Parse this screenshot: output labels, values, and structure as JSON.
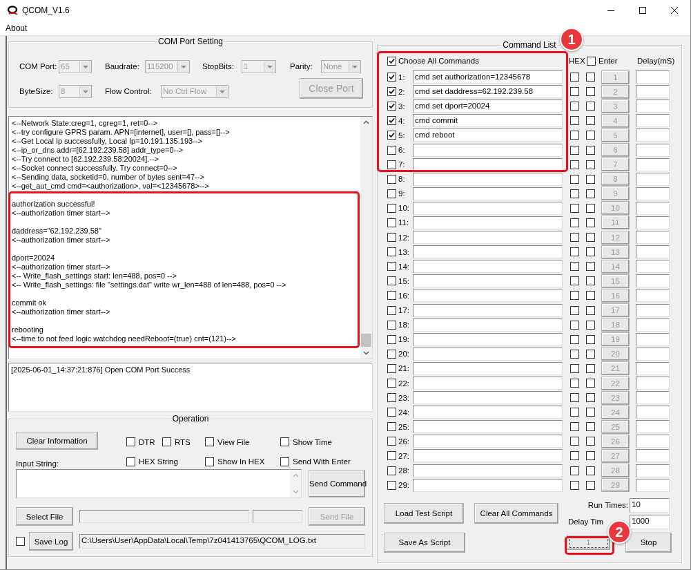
{
  "window": {
    "title": "QCOM_V1.6"
  },
  "menu": [
    "About"
  ],
  "com_port_setting": {
    "title": "COM Port Setting",
    "fields": [
      {
        "label": "COM Port:",
        "value": "65",
        "disabled": true
      },
      {
        "label": "Baudrate:",
        "value": "115200",
        "disabled": true
      },
      {
        "label": "StopBits:",
        "value": "1",
        "disabled": true
      },
      {
        "label": "Parity:",
        "value": "None",
        "disabled": true
      },
      {
        "label": "ByteSize:",
        "value": "8",
        "disabled": true
      },
      {
        "label": "Flow Control:",
        "value": "No Ctrl Flow",
        "disabled": true
      }
    ],
    "button": {
      "label": "Close Port",
      "disabled": true
    }
  },
  "log": {
    "lines": [
      "<--Network State:creg=1, cgreg=1, ret=0-->",
      "<--try configure GPRS param. APN=[internet], user=[], pass=[]-->",
      "<--Get Local Ip successfully, Local Ip=10.191.135.193-->",
      "<--ip_or_dns addr=[62.192.239.58] addr_type=0-->",
      "<--Try connect to [62.192.239.58:20024].-->",
      "<--Socket connect successfully. Try connect=0-->",
      "<--Sending data, socketid=0, number of bytes sent=47-->",
      "<--get_aut_cmd cmd=<authorization>, val=<12345678>-->"
    ],
    "blocks": [
      [
        "authorization successful!",
        "<--authorization timer start-->"
      ],
      [
        "daddress=\"62.192.239.58\"",
        "<--authorization timer start-->"
      ],
      [
        "dport=20024",
        "<--authorization timer start-->",
        "<-- Write_flash_settings start: len=488, pos=0 -->",
        "<-- Write_flash_settings: file \"settings.dat\" write wr_len=488 of len=488, pos=0 -->"
      ],
      [
        "commit ok",
        "<--authorization timer start-->"
      ],
      [
        "rebooting",
        "<--time to not feed logic watchdog needReboot=(true) cnt=(121)-->"
      ]
    ]
  },
  "info": [
    "[2025-06-01_14:37:21:876] Open COM Port Success"
  ],
  "operation": {
    "title": "Operation",
    "clear_button": "Clear Information",
    "options": [
      {
        "label": "DTR",
        "checked": false
      },
      {
        "label": "RTS",
        "checked": false
      },
      {
        "label": "View File",
        "checked": false
      },
      {
        "label": "Show Time",
        "checked": false
      },
      {
        "label": "HEX String",
        "checked": false
      },
      {
        "label": "Show In HEX",
        "checked": false
      },
      {
        "label": "Send With Enter",
        "checked": false
      }
    ],
    "input_label": "Input String:",
    "send_button": "Send Command",
    "select_file_button": "Select File",
    "send_file_button": {
      "label": "Send File",
      "disabled": true
    },
    "save_log": {
      "checked": false,
      "button": "Save Log",
      "path": "C:\\Users\\User\\AppData\\Local\\Temp\\7z041413765\\QCOM_LOG.txt"
    }
  },
  "command_list": {
    "title": "Command List",
    "choose_all": {
      "label": "Choose All Commands",
      "checked": true
    },
    "hex_header": "HEX",
    "enter_header": {
      "label": "Enter",
      "checked": false
    },
    "delay_header": "Delay(mS)",
    "rows": [
      {
        "label": "1:",
        "checked": true,
        "value": "cmd set authorization=12345678",
        "hex": false,
        "enter": false,
        "send": "1"
      },
      {
        "label": "2:",
        "checked": true,
        "value": "cmd set daddress=62.192.239.58",
        "hex": false,
        "enter": false,
        "send": "2"
      },
      {
        "label": "3:",
        "checked": true,
        "value": "cmd set dport=20024",
        "hex": false,
        "enter": false,
        "send": "3"
      },
      {
        "label": "4:",
        "checked": true,
        "value": "cmd commit",
        "hex": false,
        "enter": false,
        "send": "4"
      },
      {
        "label": "5:",
        "checked": true,
        "value": "cmd reboot",
        "hex": false,
        "enter": false,
        "send": "5"
      },
      {
        "label": "6:",
        "checked": false,
        "hex": false,
        "enter": false,
        "send": "6"
      },
      {
        "label": "7:",
        "checked": false,
        "hex": false,
        "enter": false,
        "send": "7"
      },
      {
        "label": "8:",
        "checked": false,
        "hex": false,
        "enter": false,
        "send": "8"
      },
      {
        "label": "9:",
        "checked": false,
        "hex": false,
        "enter": false,
        "send": "9"
      },
      {
        "label": "10:",
        "checked": false,
        "hex": false,
        "enter": false,
        "send": "10"
      },
      {
        "label": "11:",
        "checked": false,
        "hex": false,
        "enter": false,
        "send": "11"
      },
      {
        "label": "12:",
        "checked": false,
        "hex": false,
        "enter": false,
        "send": "12"
      },
      {
        "label": "13:",
        "checked": false,
        "hex": false,
        "enter": false,
        "send": "13"
      },
      {
        "label": "14:",
        "checked": false,
        "hex": false,
        "enter": false,
        "send": "14"
      },
      {
        "label": "15:",
        "checked": false,
        "hex": false,
        "enter": false,
        "send": "15"
      },
      {
        "label": "16:",
        "checked": false,
        "hex": false,
        "enter": false,
        "send": "16"
      },
      {
        "label": "17:",
        "checked": false,
        "hex": false,
        "enter": false,
        "send": "17"
      },
      {
        "label": "18:",
        "checked": false,
        "hex": false,
        "enter": false,
        "send": "18"
      },
      {
        "label": "19:",
        "checked": false,
        "hex": false,
        "enter": false,
        "send": "19"
      },
      {
        "label": "20:",
        "checked": false,
        "hex": false,
        "enter": false,
        "send": "20"
      },
      {
        "label": "21:",
        "checked": false,
        "hex": false,
        "enter": false,
        "send": "21"
      },
      {
        "label": "22:",
        "checked": false,
        "hex": false,
        "enter": false,
        "send": "22"
      },
      {
        "label": "23:",
        "checked": false,
        "hex": false,
        "enter": false,
        "send": "23"
      },
      {
        "label": "24:",
        "checked": false,
        "hex": false,
        "enter": false,
        "send": "24"
      },
      {
        "label": "25:",
        "checked": false,
        "hex": false,
        "enter": false,
        "send": "25"
      },
      {
        "label": "26:",
        "checked": false,
        "hex": false,
        "enter": false,
        "send": "26"
      },
      {
        "label": "27:",
        "checked": false,
        "hex": false,
        "enter": false,
        "send": "27"
      },
      {
        "label": "28:",
        "checked": false,
        "hex": false,
        "enter": false,
        "send": "28"
      },
      {
        "label": "29:",
        "checked": false,
        "hex": false,
        "enter": false,
        "send": "29"
      }
    ],
    "send_buttons_disabled": true,
    "load_button": "Load Test Script",
    "clear_button": "Clear All Commands",
    "run_times": {
      "label": "Run Times:",
      "value": "10"
    },
    "delay_time": {
      "label": "Delay Tim",
      "value": "1000"
    },
    "save_button": "Save As Script",
    "counter_button": {
      "label": "1",
      "disabled": true
    },
    "stop_button": "Stop"
  },
  "annotations": [
    {
      "kind": "frame"
    },
    {
      "kind": "badge_frame",
      "label": "1"
    },
    {
      "kind": "badge_frame",
      "label": "2"
    }
  ]
}
